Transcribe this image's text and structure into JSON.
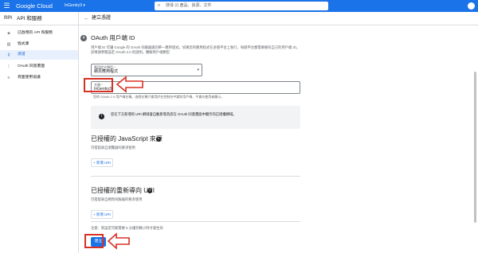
{
  "topbar": {
    "logo": "Google Cloud",
    "project": "InGentry3 ▾",
    "search_placeholder": "搜尋 (/) 產品、資源、文件",
    "menu_icon": "menu-icon",
    "search_icon": "search-icon"
  },
  "sidebar": {
    "header_icon": "RPI",
    "header_title": "API 和服務",
    "items": [
      {
        "label": "已啟用的 API 和服務",
        "icon": "dashboard-icon"
      },
      {
        "label": "程式庫",
        "icon": "library-icon"
      },
      {
        "label": "憑證",
        "icon": "key-icon"
      },
      {
        "label": "OAuth 同意畫面",
        "icon": "consent-icon"
      },
      {
        "label": "頁面使用協議",
        "icon": "agreement-icon"
      }
    ]
  },
  "header": {
    "back_icon": "←",
    "title": "建立憑證"
  },
  "main": {
    "step_number": "4",
    "section_title": "OAuth 用戶端 ID",
    "description": "用戶端 ID 可讓 Google 的 OAuth 伺服器識別單一應用程式。如果您的應用程式在多個平台上執行，每個平台都需要擁有自己的用戶端 ID。詳情請參閱設定 OAuth 2.0 的說明。瞭解用戶端類型",
    "app_type": {
      "label": "應用程式類型 *",
      "value": "網頁應用程式"
    },
    "name_field": {
      "label": "名稱 *",
      "value": "InGentry3",
      "hint": "您的 OAuth 2.0 用戶端名稱。這個名稱只會用於在控制台中識別用戶端，不會向使用者顯示。"
    },
    "info": {
      "text": "您在下方新增的 URI 網域會自動新增為您在 OAuth 同意畫面中顯示的已授權網域。"
    },
    "js_origins": {
      "title": "已授權的 JavaScript 來源",
      "subtitle": "可搭配來自瀏覽器的要求使用",
      "add_label": "+ 新增 URI"
    },
    "redirect_uris": {
      "title": "已授權的重新導向 URI",
      "subtitle": "可搭配來自網頁伺服器的要求使用",
      "add_label": "+ 新增 URI"
    },
    "note": "注意：新設定可能需要 5 分鐘到幾小時才會生效",
    "create_label": "建立"
  },
  "colors": {
    "accent": "#1a73e8",
    "highlight": "#d93025"
  }
}
